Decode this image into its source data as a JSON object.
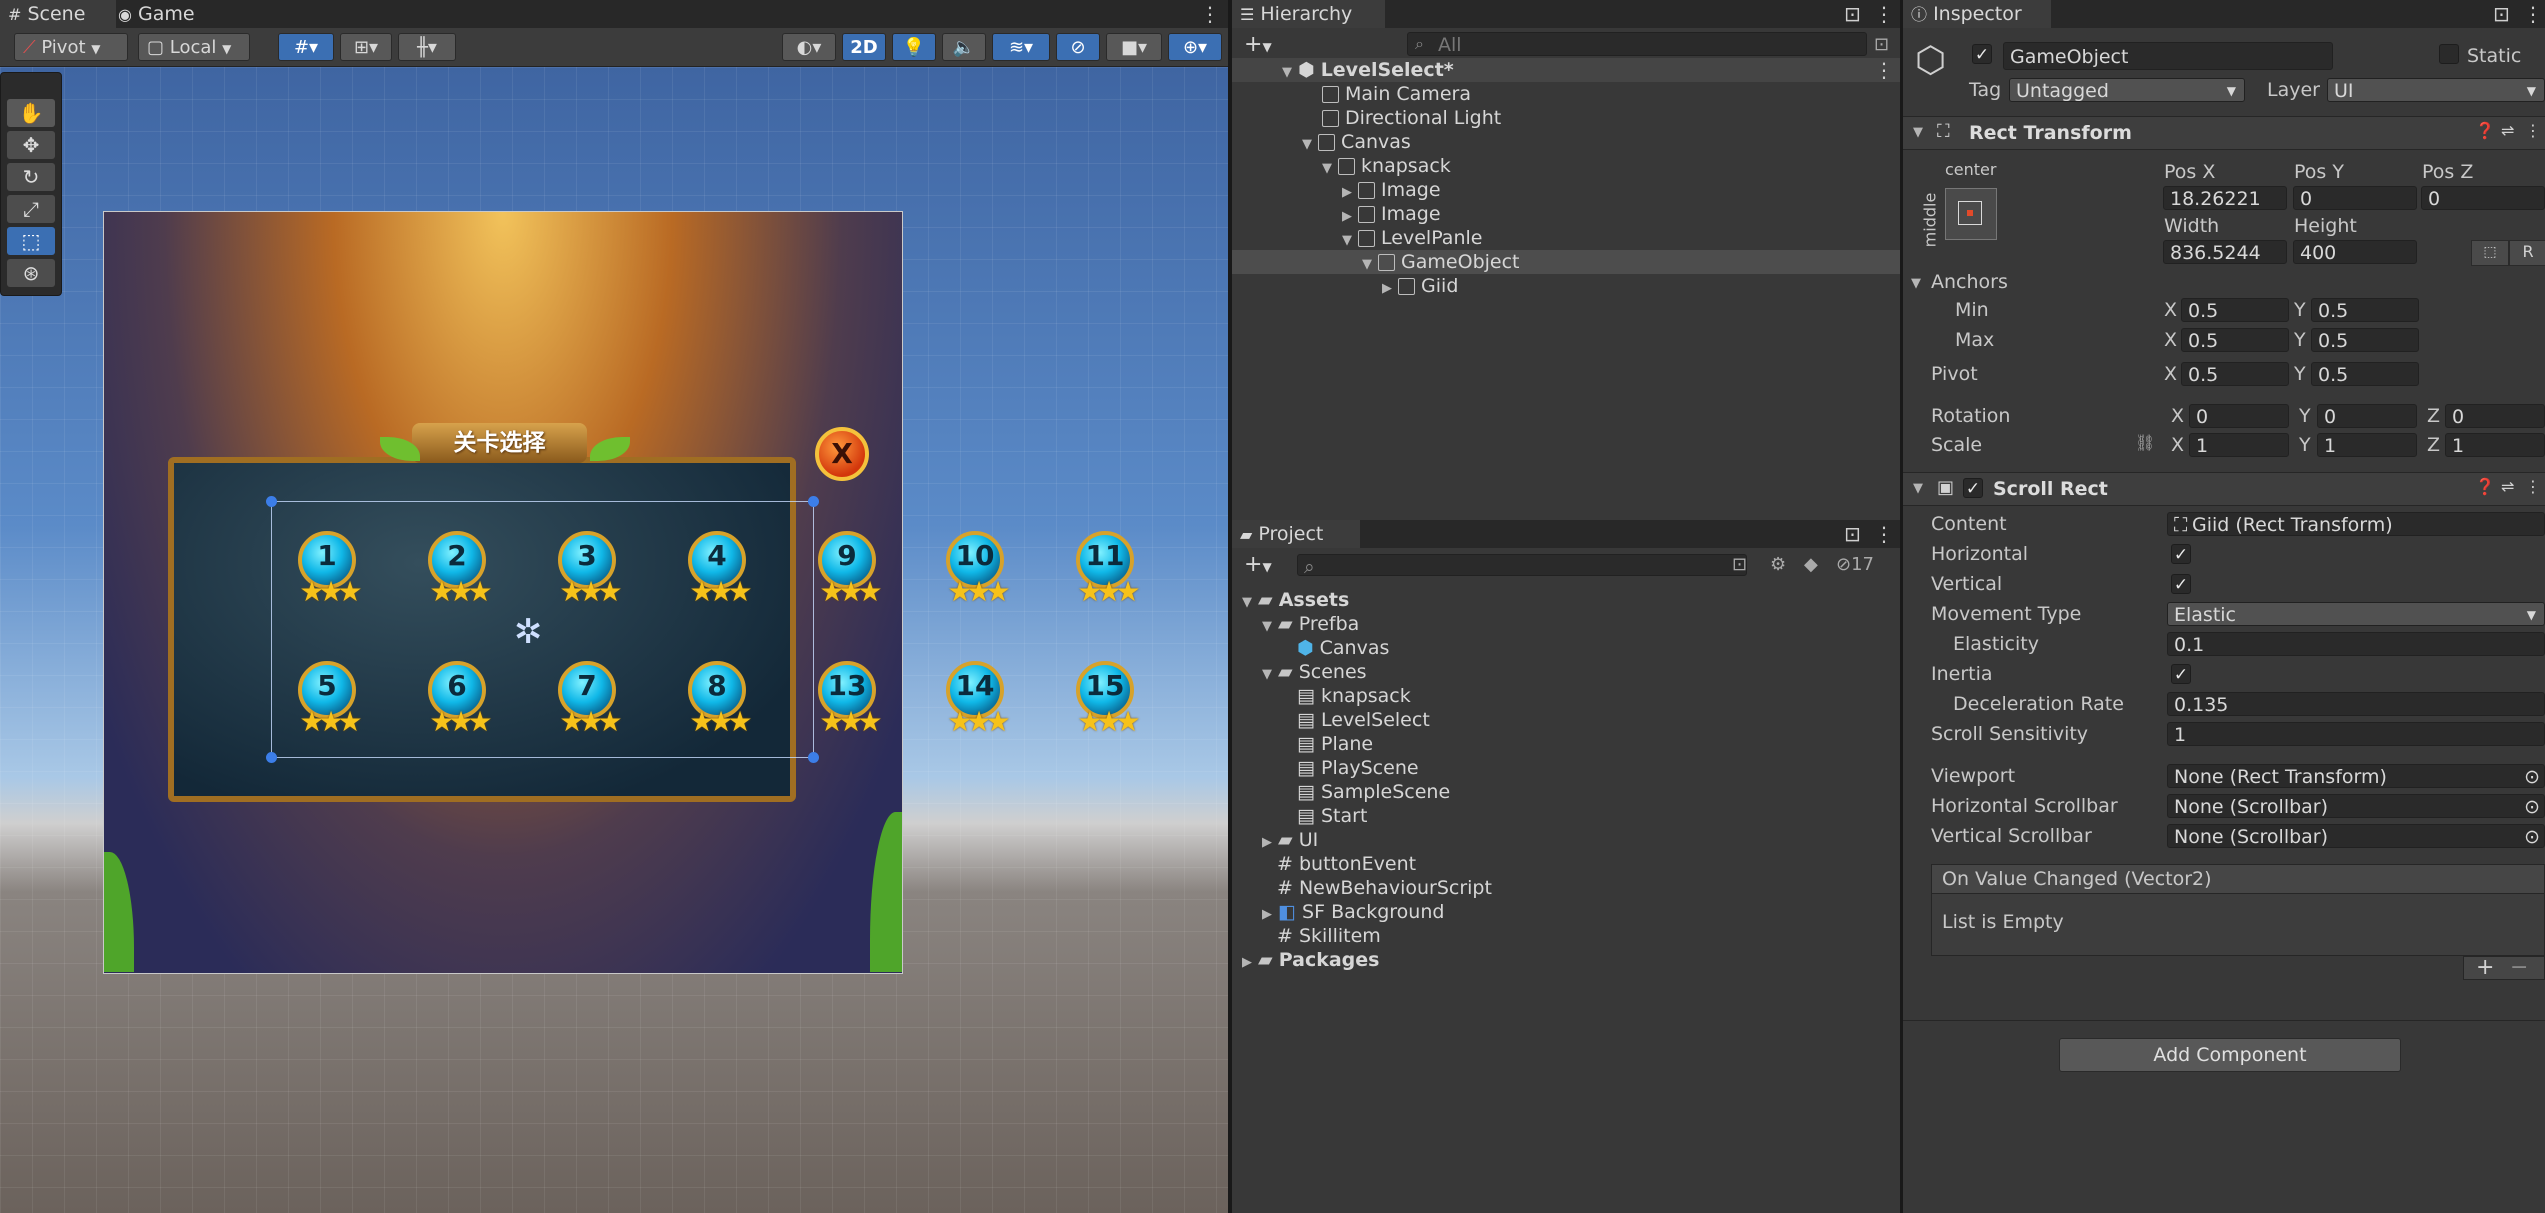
{
  "scene": {
    "tabs": [
      {
        "label": "Scene"
      },
      {
        "label": "Game"
      }
    ],
    "toolbar": {
      "pivot": "Pivot",
      "local": "Local",
      "mode2d": "2D"
    },
    "panel_title": "关卡选择",
    "close": "X",
    "levels": [
      "1",
      "2",
      "3",
      "4",
      "9",
      "10",
      "11",
      "5",
      "6",
      "7",
      "8",
      "13",
      "14",
      "15"
    ]
  },
  "hierarchy": {
    "title": "Hierarchy",
    "search_placeholder": "All",
    "items": [
      {
        "label": "LevelSelect*"
      },
      {
        "label": "Main Camera"
      },
      {
        "label": "Directional Light"
      },
      {
        "label": "Canvas"
      },
      {
        "label": "knapsack"
      },
      {
        "label": "Image"
      },
      {
        "label": "Image"
      },
      {
        "label": "LevelPanle"
      },
      {
        "label": "GameObject"
      },
      {
        "label": "Giid"
      }
    ]
  },
  "project": {
    "title": "Project",
    "badge": "17",
    "items": [
      {
        "label": "Assets"
      },
      {
        "label": "Prefba"
      },
      {
        "label": "Canvas"
      },
      {
        "label": "Scenes"
      },
      {
        "label": "knapsack"
      },
      {
        "label": "LevelSelect"
      },
      {
        "label": "Plane"
      },
      {
        "label": "PlayScene"
      },
      {
        "label": "SampleScene"
      },
      {
        "label": "Start"
      },
      {
        "label": "UI"
      },
      {
        "label": "buttonEvent"
      },
      {
        "label": "NewBehaviourScript"
      },
      {
        "label": "SF Background"
      },
      {
        "label": "Skillitem"
      },
      {
        "label": "Packages"
      }
    ]
  },
  "inspector": {
    "title": "Inspector",
    "name": "GameObject",
    "static": "Static",
    "tag_label": "Tag",
    "tag": "Untagged",
    "layer_label": "Layer",
    "layer": "UI",
    "rect": {
      "title": "Rect Transform",
      "anchor_h": "center",
      "anchor_v": "middle",
      "posx_l": "Pos X",
      "posy_l": "Pos Y",
      "posz_l": "Pos Z",
      "posx": "18.26221",
      "posy": "0",
      "posz": "0",
      "width_l": "Width",
      "height_l": "Height",
      "width": "836.5244",
      "height": "400",
      "anchors": "Anchors",
      "min": "Min",
      "max": "Max",
      "pivot": "Pivot",
      "rotation": "Rotation",
      "scale": "Scale",
      "x": "X",
      "y": "Y",
      "z": "Z",
      "min_x": "0.5",
      "min_y": "0.5",
      "max_x": "0.5",
      "max_y": "0.5",
      "pivot_x": "0.5",
      "pivot_y": "0.5",
      "rot_x": "0",
      "rot_y": "0",
      "rot_z": "0",
      "scale_x": "1",
      "scale_y": "1",
      "scale_z": "1",
      "r_btn": "R"
    },
    "scroll": {
      "title": "Scroll Rect",
      "content_l": "Content",
      "content": "Giid (Rect Transform)",
      "horizontal_l": "Horizontal",
      "vertical_l": "Vertical",
      "movement_l": "Movement Type",
      "movement": "Elastic",
      "elasticity_l": "Elasticity",
      "elasticity": "0.1",
      "inertia_l": "Inertia",
      "decel_l": "Deceleration Rate",
      "decel": "0.135",
      "sens_l": "Scroll Sensitivity",
      "sens": "1",
      "viewport_l": "Viewport",
      "viewport": "None (Rect Transform)",
      "hscroll_l": "Horizontal Scrollbar",
      "hscroll": "None (Scrollbar)",
      "vscroll_l": "Vertical Scrollbar",
      "vscroll": "None (Scrollbar)",
      "event": "On Value Changed (Vector2)",
      "empty": "List is Empty",
      "plus": "+",
      "minus": "−"
    },
    "add_component": "Add Component"
  }
}
